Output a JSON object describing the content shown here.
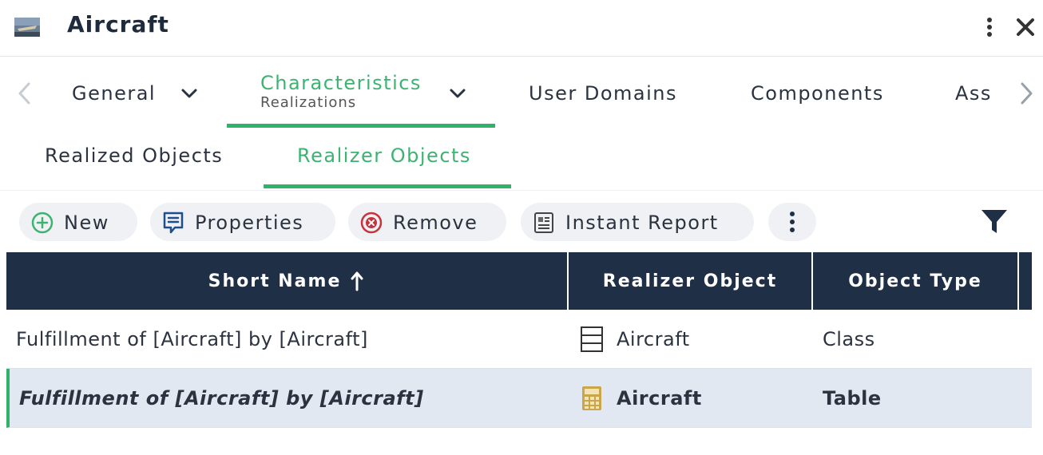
{
  "header": {
    "title": "Aircraft",
    "icons": {
      "app": "aircraft-image-icon",
      "menu": "vertical-ellipsis-icon",
      "close": "close-icon"
    }
  },
  "tabs_primary": [
    {
      "label": "General",
      "has_dropdown": true,
      "active": false
    },
    {
      "label": "Characteristics",
      "sublabel": "Realizations",
      "has_dropdown": true,
      "active": true
    },
    {
      "label": "User Domains",
      "active": false
    },
    {
      "label": "Components",
      "active": false
    },
    {
      "label": "Ass",
      "active": false
    }
  ],
  "tabs_secondary": [
    {
      "label": "Realized Objects",
      "active": false
    },
    {
      "label": "Realizer Objects",
      "active": true
    }
  ],
  "toolbar": {
    "new": {
      "label": "New",
      "icon": "plus-circle-icon"
    },
    "properties": {
      "label": "Properties",
      "icon": "properties-icon"
    },
    "remove": {
      "label": "Remove",
      "icon": "remove-circle-icon"
    },
    "instant_report": {
      "label": "Instant Report",
      "icon": "report-icon"
    },
    "more_icon": "vertical-ellipsis-icon",
    "filter_icon": "filter-icon"
  },
  "table": {
    "columns": [
      "Short Name",
      "Realizer Object",
      "Object Type"
    ],
    "sort": {
      "column": "Short Name",
      "direction": "ascending"
    },
    "rows": [
      {
        "short_name": "Fulfillment of [Aircraft] by [Aircraft]",
        "realizer_object": "Aircraft",
        "realizer_icon": "class-icon",
        "object_type": "Class",
        "selected": false
      },
      {
        "short_name": "Fulfillment of [Aircraft] by [Aircraft]",
        "realizer_object": "Aircraft",
        "realizer_icon": "table-icon",
        "object_type": "Table",
        "selected": true
      }
    ]
  },
  "colors": {
    "accent": "#2fb36b",
    "header_bg": "#1f2f45",
    "selected_row": "#e1e8f2"
  }
}
